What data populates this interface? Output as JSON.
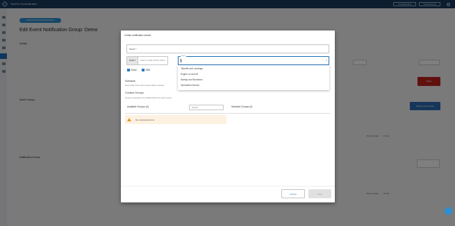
{
  "topbar": {
    "app_title": "TrueFlux Demonstration",
    "knowledge_base": "Knowledge Base",
    "troubleshooting": "Troubleshooting",
    "help_icon": "?"
  },
  "page": {
    "back_label": "EVENT NOTIFICATION GROUPS",
    "title": "Edit Event Notification Group: Demo",
    "details_label": "Details",
    "asset_groups_label": "Asset Groups",
    "notification_events_label": "Notification Events",
    "delete_label": "Delete",
    "manage_asset_groups_label": "Manage Asset Groups",
    "rows_per_page_label": "Rows per page:",
    "rows_per_page_value": "10 rows"
  },
  "modal": {
    "title": "Create notification search",
    "name_label": "Name *",
    "toggle_event": "EVENT",
    "toggle_event_code": "EVENT CODE (STAFF ONLY)",
    "event_field_label": "Event",
    "dropdown_arrow": "▾",
    "dropdown_options": [
      "Takeoffs and Landings",
      "Engine on and off",
      "Startup and Shutdown",
      "Operations Normal"
    ],
    "email_label": "Email",
    "sms_label": "SMS",
    "schedule_title": "Schedule",
    "schedule_sub": "Only notify if the event occurs within a chosen",
    "contact_groups_title": "Contact Groups",
    "contact_groups_sub": "Groups of people to be notified when the event occurs",
    "available_groups": "Available Groups (0)",
    "search_placeholder": "Search",
    "selected_groups": "Selected Groups (0)",
    "warning_text": "No unselected items",
    "cancel_label": "Cancel",
    "save_label": "Save"
  }
}
